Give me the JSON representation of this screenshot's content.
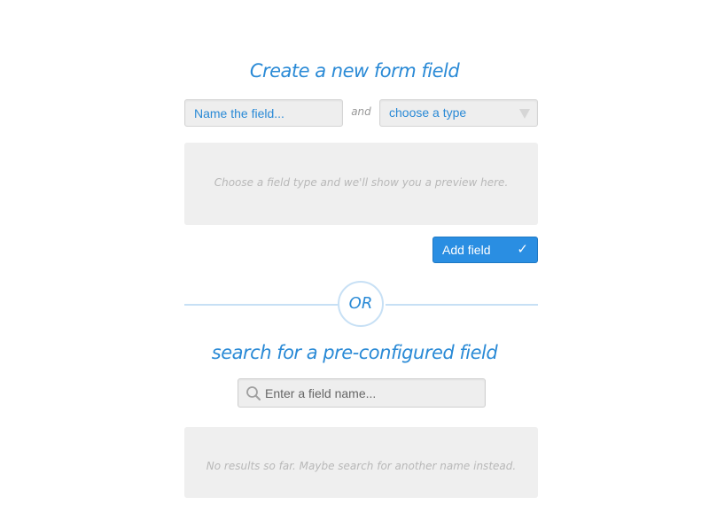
{
  "create_section": {
    "heading": "Create a new form field",
    "name_placeholder": "Name the field...",
    "and_label": "and",
    "type_select_value": "choose a type",
    "preview_text": "Choose a field type and we'll show you a preview here.",
    "add_button_label": "Add field",
    "add_button_icon": "checkmark-icon"
  },
  "divider": {
    "label": "OR"
  },
  "search_section": {
    "heading": "search for a pre-configured field",
    "search_placeholder": "Enter a field name...",
    "search_icon": "search-icon",
    "results_text": "No results so far. Maybe search for another name instead."
  },
  "colors": {
    "accent": "#2a8ad6",
    "button": "#2a8ee2",
    "divider": "#c7e0f5",
    "field_bg": "#eeeeee"
  }
}
